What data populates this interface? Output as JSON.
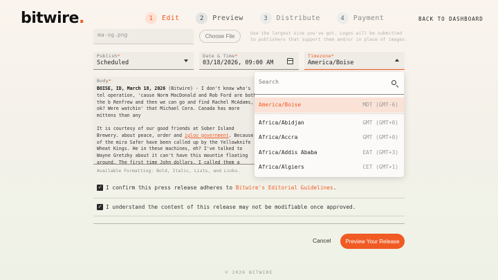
{
  "brand": {
    "name": "bitwire",
    "dot": "."
  },
  "steps": [
    {
      "num": "1",
      "label": "Edit"
    },
    {
      "num": "2",
      "label": "Preview"
    },
    {
      "num": "3",
      "label": "Distribute"
    },
    {
      "num": "4",
      "label": "Payment"
    }
  ],
  "header": {
    "back_label": "BACK TO DASHBOARD"
  },
  "image": {
    "filename": "ma-og.png",
    "choose_label": "Choose File",
    "hint": "Use the largest size you've got. Logos will be submitted to publishers that support them and/or in place of images."
  },
  "publish": {
    "label": "Publish",
    "req": "*",
    "value": "Scheduled"
  },
  "datetime": {
    "label": "Date & Time",
    "req": "*",
    "value": "03/18/2026, 09:00 AM"
  },
  "timezone": {
    "label": "Timezone",
    "req": "*",
    "value": "America/Boise"
  },
  "body": {
    "label": "Body",
    "req": "*",
    "dateline": "BOISE, ID, March 18, 2026",
    "p1": " (Bitwire) - I don't know who's tel operation, 'cause Norm MacDonald and Rob Ford are both the b Renfrew and then we can go and find Rachel McAdams, ok? Were watchin' that Michael Cera. Canada has more mittens than any",
    "p2_a": "It is courtesy of our good friends at Sober Island Brewery. about peace, order and ",
    "p2_link": "igloo government",
    "p2_b": ". Because of the mira Safer have been called up by the Yellowknife Wheat Kings. He in these machines, eh? I've talked to Wayne Gretzky about it can't have this mountie floating around. The first time John dollars, I called them a hoser, eh. We put on our double-dou",
    "formatting": "Available Formatting: Bold, Italic, Lists, and Links."
  },
  "confirm1": {
    "text": "I confirm this press release adheres to ",
    "link": "Bitwire's Editorial Guidelines",
    "end": "."
  },
  "confirm2": {
    "text": "I understand the content of this release may not be modifiable once approved."
  },
  "actions": {
    "cancel": "Cancel",
    "preview": "Preview Your Release"
  },
  "footer": "© 2026 BITWIRE",
  "dropdown": {
    "placeholder": "Search",
    "selected": {
      "name": "America/Boise",
      "offset": "MDT (GMT-6)"
    },
    "items": [
      {
        "name": "Africa/Abidjan",
        "offset": "GMT (GMT+0)"
      },
      {
        "name": "Africa/Accra",
        "offset": "GMT (GMT+0)"
      },
      {
        "name": "Africa/Addis Ababa",
        "offset": "EAT (GMT+3)"
      },
      {
        "name": "Africa/Algiers",
        "offset": "CET (GMT+1)"
      }
    ]
  },
  "colors": {
    "accent": "#f05a23",
    "selected_bg": "#fbe2d7"
  }
}
